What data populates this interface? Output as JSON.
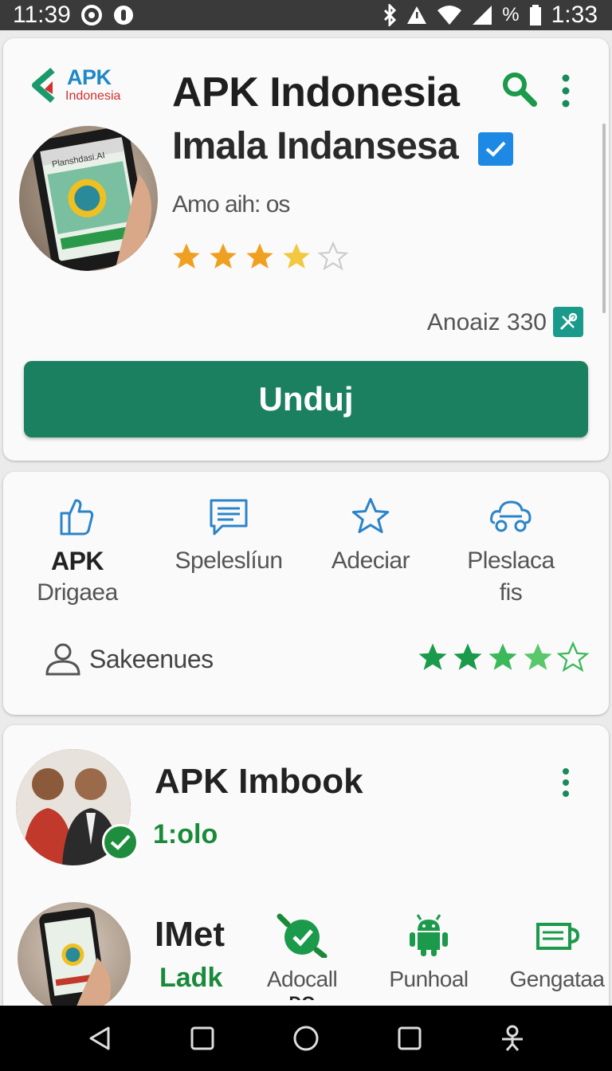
{
  "status_bar": {
    "time_left": "11:39",
    "battery_text": "%",
    "time_right": "1:33"
  },
  "app": {
    "logo_text": "APK",
    "logo_sub": "Indonesia",
    "title": "APK Indonesia",
    "subtitle": "Imala Indansesa",
    "developer": "Amo aih: os",
    "rating": 3.5,
    "size_text": "Anoaiz 330",
    "download_label": "Unduj",
    "screen_text": "Planshdasi.AI"
  },
  "features": {
    "items": [
      {
        "label": "APK",
        "sub": "Drigaea",
        "icon": "thumbs-up-icon"
      },
      {
        "label": "Speleslíun",
        "icon": "message-icon"
      },
      {
        "label": "Adeciar",
        "icon": "star-icon"
      },
      {
        "label": "Pleslaca",
        "sub": "fis",
        "icon": "cloud-car-icon"
      }
    ],
    "reviewers_label": "Sakeenues",
    "rating": 4
  },
  "list": {
    "item1": {
      "title": "APK Imbook",
      "meta": "1:olo"
    },
    "item2": {
      "title": "IMet",
      "meta": "Ladk"
    },
    "actions": [
      {
        "label": "Adocall",
        "icon": "check-badge-icon"
      },
      {
        "label": "Punhoal",
        "icon": "android-icon"
      },
      {
        "label": "Gengataa",
        "icon": "cup-icon"
      }
    ],
    "partial_text": "DO"
  },
  "colors": {
    "accent": "#1a8060",
    "star_orange": "#f0a020",
    "star_green": "#22aa44",
    "blue_icon": "#2b84c8"
  }
}
